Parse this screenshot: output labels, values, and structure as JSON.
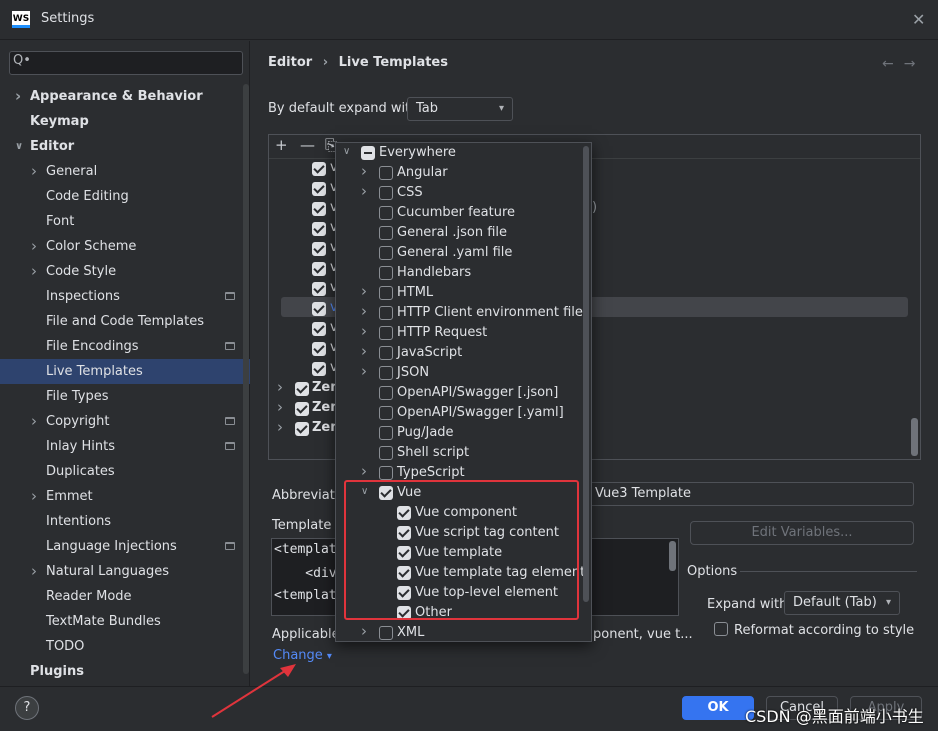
{
  "window": {
    "title": "Settings",
    "logo_text": "WS"
  },
  "search": {
    "placeholder": "Q•"
  },
  "sidebar": {
    "items": [
      {
        "label": "Appearance & Behavior",
        "bold": true
      },
      {
        "label": "Keymap",
        "bold": true
      },
      {
        "label": "Editor",
        "bold": true
      },
      {
        "label": "General"
      },
      {
        "label": "Code Editing"
      },
      {
        "label": "Font"
      },
      {
        "label": "Color Scheme"
      },
      {
        "label": "Code Style"
      },
      {
        "label": "Inspections"
      },
      {
        "label": "File and Code Templates"
      },
      {
        "label": "File Encodings"
      },
      {
        "label": "Live Templates",
        "selected": true
      },
      {
        "label": "File Types"
      },
      {
        "label": "Copyright"
      },
      {
        "label": "Inlay Hints"
      },
      {
        "label": "Duplicates"
      },
      {
        "label": "Emmet"
      },
      {
        "label": "Intentions"
      },
      {
        "label": "Language Injections"
      },
      {
        "label": "Natural Languages"
      },
      {
        "label": "Reader Mode"
      },
      {
        "label": "TextMate Bundles"
      },
      {
        "label": "TODO"
      },
      {
        "label": "Plugins",
        "bold": true
      }
    ]
  },
  "breadcrumb": {
    "parent": "Editor",
    "sep": "›",
    "current": "Live Templates"
  },
  "nav": {
    "arrows": "←→"
  },
  "expand": {
    "label": "By default expand with",
    "value": "Tab"
  },
  "toolbar": {
    "add": "+",
    "remove": "—",
    "copy": "⎘"
  },
  "template_list": {
    "row_prefix": "v",
    "groups": [
      {
        "label": "Zen"
      },
      {
        "label": "Zen"
      },
      {
        "label": "Zen"
      }
    ],
    "partial_text": ")"
  },
  "abbreviation": {
    "label": "Abbreviatio",
    "description_value": "Vue3 Template"
  },
  "template_text": {
    "label": "Template t",
    "lines": [
      "<templat",
      "    <div",
      "<templat"
    ]
  },
  "edit_variables": {
    "label": "Edit Variables..."
  },
  "options": {
    "title": "Options",
    "expand_label": "Expand with",
    "expand_value": "Default (Tab)",
    "reformat_label": "Reformat according to style"
  },
  "applicable": {
    "label": "Applicable",
    "suffix": "ponent, vue t...",
    "change_link": "Change"
  },
  "context_popup": {
    "items": [
      {
        "label": "Everywhere",
        "level": 0,
        "state": "part",
        "chevron": "down"
      },
      {
        "label": "Angular",
        "level": 1,
        "state": "off",
        "chevron": "right"
      },
      {
        "label": "CSS",
        "level": 1,
        "state": "off",
        "chevron": "right"
      },
      {
        "label": "Cucumber feature",
        "level": 1,
        "state": "off"
      },
      {
        "label": "General .json file",
        "level": 1,
        "state": "off"
      },
      {
        "label": "General .yaml file",
        "level": 1,
        "state": "off"
      },
      {
        "label": "Handlebars",
        "level": 1,
        "state": "off"
      },
      {
        "label": "HTML",
        "level": 1,
        "state": "off",
        "chevron": "right"
      },
      {
        "label": "HTTP Client environment file",
        "level": 1,
        "state": "off",
        "chevron": "right"
      },
      {
        "label": "HTTP Request",
        "level": 1,
        "state": "off",
        "chevron": "right"
      },
      {
        "label": "JavaScript",
        "level": 1,
        "state": "off",
        "chevron": "right"
      },
      {
        "label": "JSON",
        "level": 1,
        "state": "off",
        "chevron": "right"
      },
      {
        "label": "OpenAPI/Swagger [.json]",
        "level": 1,
        "state": "off"
      },
      {
        "label": "OpenAPI/Swagger [.yaml]",
        "level": 1,
        "state": "off"
      },
      {
        "label": "Pug/Jade",
        "level": 1,
        "state": "off"
      },
      {
        "label": "Shell script",
        "level": 1,
        "state": "off"
      },
      {
        "label": "TypeScript",
        "level": 1,
        "state": "off",
        "chevron": "right"
      },
      {
        "label": "Vue",
        "level": 1,
        "state": "on",
        "chevron": "down"
      },
      {
        "label": "Vue component",
        "level": 2,
        "state": "on"
      },
      {
        "label": "Vue script tag content",
        "level": 2,
        "state": "on"
      },
      {
        "label": "Vue template",
        "level": 2,
        "state": "on"
      },
      {
        "label": "Vue template tag element",
        "level": 2,
        "state": "on"
      },
      {
        "label": "Vue top-level element",
        "level": 2,
        "state": "on"
      },
      {
        "label": "Other",
        "level": 2,
        "state": "on"
      },
      {
        "label": "XML",
        "level": 1,
        "state": "off",
        "chevron": "right"
      }
    ]
  },
  "footer": {
    "help": "?",
    "ok": "OK",
    "cancel": "Cancel",
    "apply": "Apply"
  },
  "watermark": "CSDN @黑面前端小书生",
  "colors": {
    "accent": "#3574f0",
    "selection": "#2e436e",
    "highlight_box": "#e0343c",
    "link": "#548af7"
  }
}
